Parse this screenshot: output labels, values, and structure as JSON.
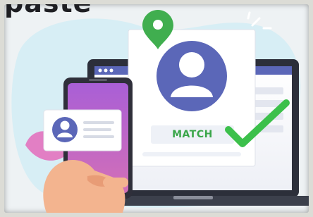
{
  "corner_text": "paste",
  "profile_card": {
    "status_label": "MATCH"
  },
  "icons": {
    "location": "map-pin-icon",
    "profile": "user-avatar-icon",
    "check": "checkmark-icon",
    "sparkle": "sparkle-icon"
  },
  "colors": {
    "background": "#eef2f4",
    "blob": "#cfeaf3",
    "avatar": "#5b67b8",
    "pin": "#3fae4f",
    "check": "#3cc04b",
    "match_text": "#3aa64a",
    "phone_screen": "#b14fd0"
  }
}
